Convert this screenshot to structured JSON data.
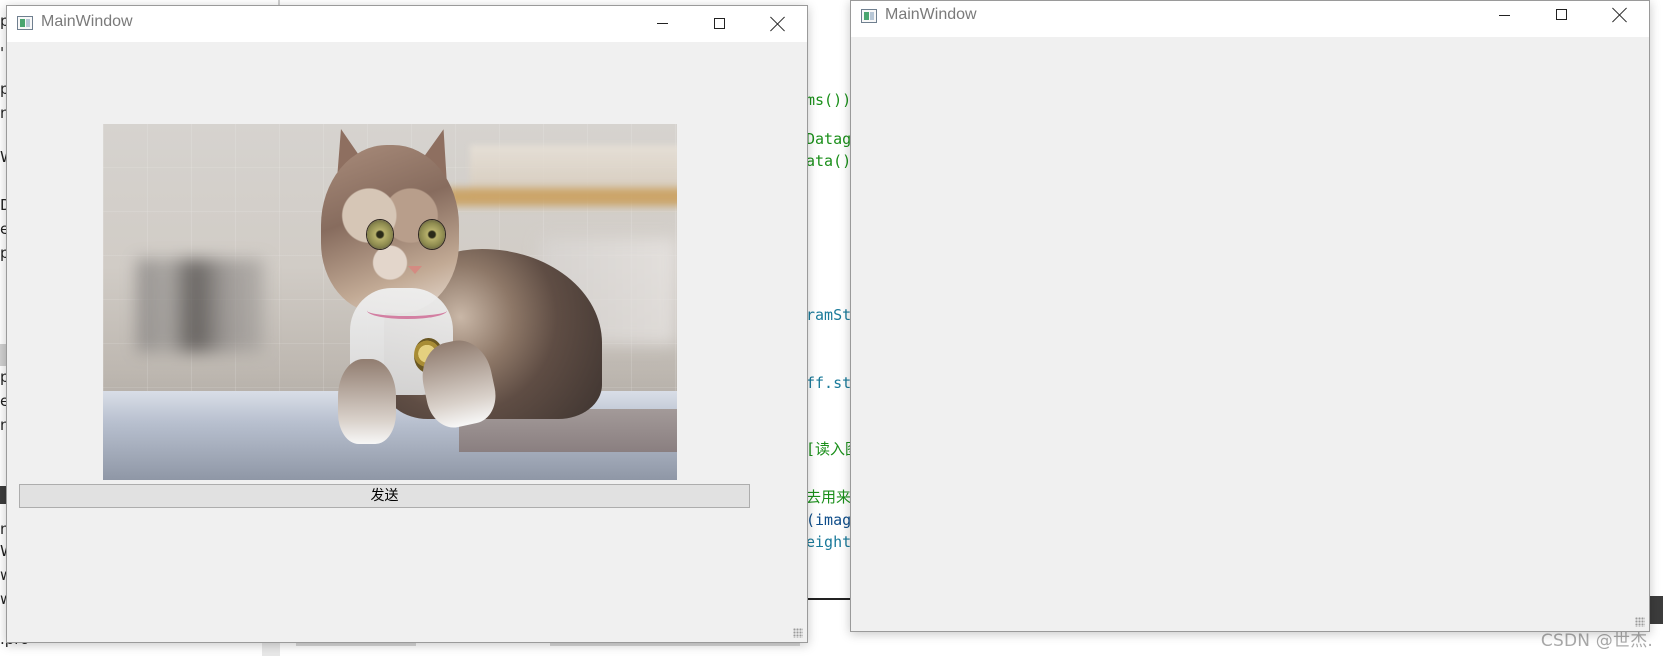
{
  "background_editor": {
    "sidebar_fragments": [
      "pl",
      "'",
      "pe",
      "n",
      "W",
      "D",
      "e",
      "pl",
      "pr",
      "e",
      "n",
      "m",
      "Wi",
      "w",
      "w",
      ".pro"
    ],
    "code_fragments": [
      "ms())",
      "Datag",
      "ata()",
      "ramSt",
      "ff.st",
      "[读入图",
      "去用来",
      "(imag",
      "eight"
    ],
    "watermark": "CSDN @世杰."
  },
  "left_window": {
    "title": "MainWindow",
    "image": "cat photo",
    "send_button": "发送"
  },
  "right_window": {
    "title": "MainWindow"
  },
  "icons": {
    "app": "app-icon",
    "minimize": "minimize-icon",
    "maximize": "maximize-icon",
    "close": "close-icon"
  }
}
